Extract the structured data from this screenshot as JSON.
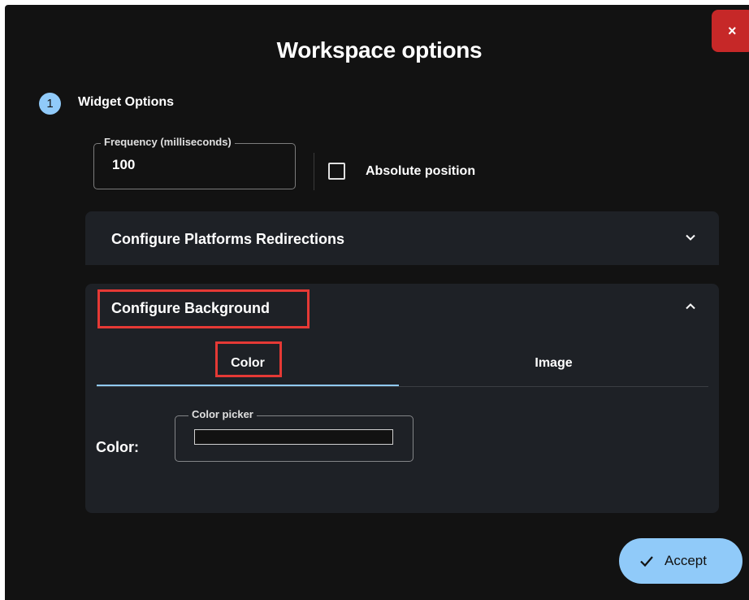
{
  "dialog": {
    "title": "Workspace options",
    "close_label": "×"
  },
  "stepper": {
    "step_number": "1",
    "step_label": "Widget Options"
  },
  "frequency": {
    "label": "Frequency (milliseconds)",
    "value": "100"
  },
  "absolute_position": {
    "label": "Absolute position",
    "checked": false
  },
  "accordions": {
    "platforms": {
      "title": "Configure Platforms Redirections",
      "expanded": false
    },
    "background": {
      "title": "Configure Background",
      "expanded": true
    }
  },
  "tabs": [
    {
      "label": "Color",
      "selected": true
    },
    {
      "label": "Image",
      "selected": false
    }
  ],
  "color_row": {
    "label": "Color:",
    "picker_label": "Color picker"
  },
  "footer": {
    "accept_label": "Accept"
  },
  "colors": {
    "dialog_bg": "#121212",
    "panel_bg": "#1e2126",
    "accent": "#90caf9",
    "close_bg": "#c62828",
    "highlight": "#e53935"
  },
  "icons": {
    "close": "close-icon",
    "chevron_down": "chevron-down-icon",
    "chevron_up": "chevron-up-icon",
    "check": "check-icon"
  }
}
